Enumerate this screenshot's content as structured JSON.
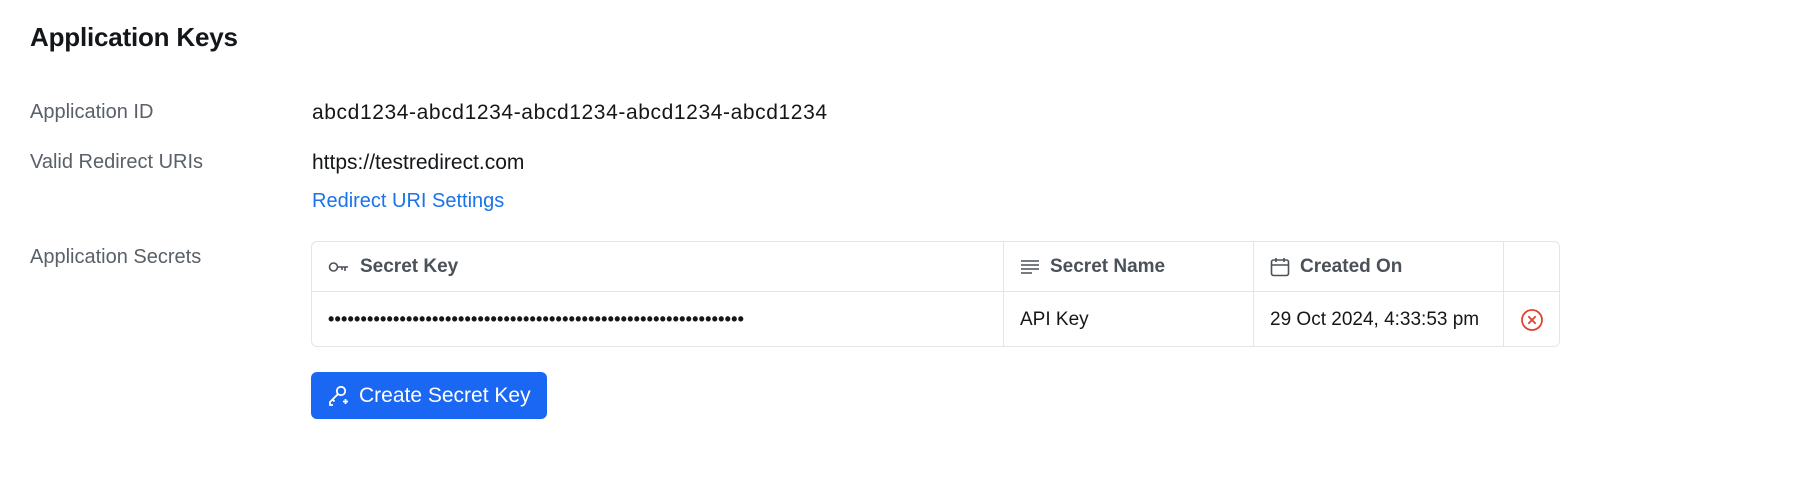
{
  "section": {
    "title": "Application Keys"
  },
  "fields": {
    "app_id": {
      "label": "Application ID",
      "value": "abcd1234-abcd1234-abcd1234-abcd1234-abcd1234"
    },
    "redirect": {
      "label": "Valid Redirect URIs",
      "value": "https://testredirect.com",
      "settings_link": "Redirect URI Settings"
    },
    "secrets": {
      "label": "Application Secrets"
    }
  },
  "secrets_table": {
    "columns": [
      {
        "label": "Secret Key",
        "icon": "key-icon"
      },
      {
        "label": "Secret Name",
        "icon": "lines-icon"
      },
      {
        "label": "Created On",
        "icon": "calendar-icon"
      }
    ],
    "rows": [
      {
        "secret": "••••••••••••••••••••••••••••••••••••••••••••••••••••••••••••••••",
        "name": "API Key",
        "created": "29 Oct 2024, 4:33:53 pm",
        "action_icon": "delete-circle-icon"
      }
    ]
  },
  "create_button": {
    "label": "Create Secret Key",
    "icon": "key-add-icon"
  },
  "colors": {
    "accent": "#1967f2",
    "link": "#1a73e8",
    "danger": "#e0432f"
  }
}
